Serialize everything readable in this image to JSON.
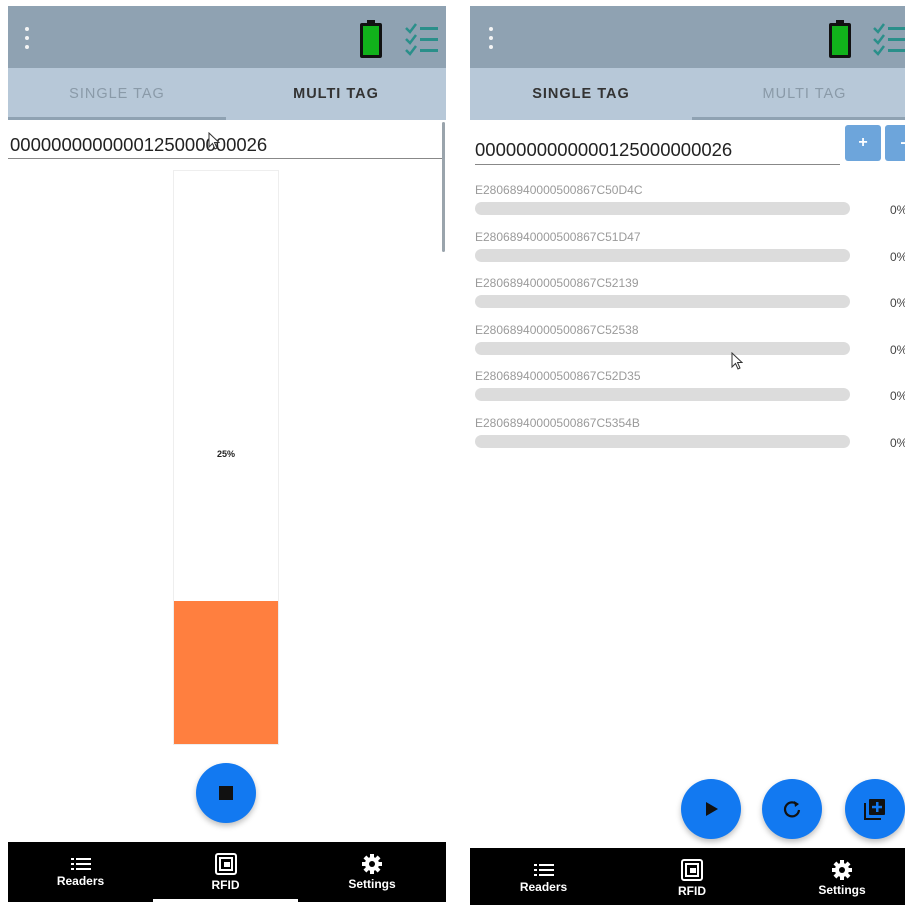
{
  "tabs": {
    "single": "SINGLE TAG",
    "multi": "MULTI TAG"
  },
  "left": {
    "tag_value": "0000000000000125000000026",
    "meter": {
      "label": "25%",
      "level": 0.25
    },
    "stop_icon": "stop-icon"
  },
  "right": {
    "tag_value": "0000000000000125000000026",
    "plus_label": "+",
    "minus_label": "-",
    "tags": [
      {
        "id": "E28068940000500867C50D4C",
        "pct": "0%",
        "level": 0
      },
      {
        "id": "E28068940000500867C51D47",
        "pct": "0%",
        "level": 0
      },
      {
        "id": "E28068940000500867C52139",
        "pct": "0%",
        "level": 0
      },
      {
        "id": "E28068940000500867C52538",
        "pct": "0%",
        "level": 0
      },
      {
        "id": "E28068940000500867C52D35",
        "pct": "0%",
        "level": 0
      },
      {
        "id": "E28068940000500867C5354B",
        "pct": "0%",
        "level": 0
      }
    ]
  },
  "nav": {
    "readers": "Readers",
    "rfid": "RFID",
    "settings": "Settings"
  },
  "colors": {
    "appbar": "#8fa2b2",
    "tabs": "#b7c8d8",
    "meter_fill": "#ff7f3f",
    "fab": "#1279f1",
    "battery": "#11b21b"
  },
  "icons": {
    "menu": "more-vert-icon",
    "battery": "battery-icon",
    "checklist": "checklist-icon",
    "play": "play-icon",
    "refresh": "refresh-icon",
    "add": "add-to-list-icon",
    "readers": "list-icon",
    "rfid": "rfid-icon",
    "settings": "gear-icon",
    "cursor": "cursor-icon"
  }
}
